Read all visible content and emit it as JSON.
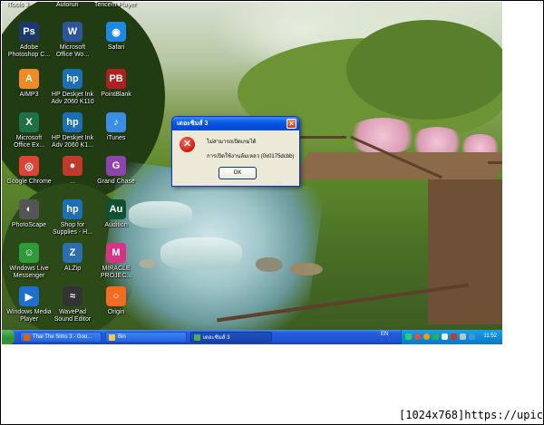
{
  "desktop_icons": [
    {
      "name": "photoshop",
      "label": "Adobe\nPhotoshop C...",
      "icon": "photoshop-icon",
      "color": "#1b3a6b",
      "glyph": "Ps"
    },
    {
      "name": "office-word",
      "label": "Microsoft\nOffice Wo...",
      "icon": "word-icon",
      "color": "#2b579a",
      "glyph": "W"
    },
    {
      "name": "safari",
      "label": "Safari",
      "icon": "compass-icon",
      "color": "#1e88e5",
      "glyph": "◉"
    },
    {
      "name": "aimp",
      "label": "AIMP3",
      "icon": "aimp-icon",
      "color": "#f08a24",
      "glyph": "A"
    },
    {
      "name": "hp-deskjet-1",
      "label": "HP Deskjet Ink\nAdv 2060 K110",
      "icon": "printer-icon",
      "color": "#1b6fb5",
      "glyph": "hp"
    },
    {
      "name": "pointblank",
      "label": "PointBlank",
      "icon": "pointblank-icon",
      "color": "#b02020",
      "glyph": "PB"
    },
    {
      "name": "office-excel",
      "label": "Microsoft\nOffice Ex...",
      "icon": "excel-icon",
      "color": "#1e7145",
      "glyph": "X"
    },
    {
      "name": "hp-deskjet-2",
      "label": "HP Deskjet Ink\nAdv 2060 K1...",
      "icon": "printer-icon",
      "color": "#1b6fb5",
      "glyph": "hp"
    },
    {
      "name": "itunes",
      "label": "iTunes",
      "icon": "itunes-icon",
      "color": "#3a8ee6",
      "glyph": "♪"
    },
    {
      "name": "google-chrome",
      "label": "Google Chrome",
      "icon": "chrome-icon",
      "color": "#db4437",
      "glyph": "◎"
    },
    {
      "name": "icon-blur",
      "label": "...",
      "icon": "app-icon",
      "color": "#c0392b",
      "glyph": "●"
    },
    {
      "name": "grand-chase",
      "label": "Grand Chase",
      "icon": "grandchase-icon",
      "color": "#8e44ad",
      "glyph": "G"
    },
    {
      "name": "photoscape",
      "label": "PhotoScape",
      "icon": "photoscape-icon",
      "color": "#555",
      "glyph": "◐"
    },
    {
      "name": "shop-supplies",
      "label": "Shop for\nSupplies - H...",
      "icon": "hp-shop-icon",
      "color": "#1b6fb5",
      "glyph": "hp"
    },
    {
      "name": "audition",
      "label": "Audition",
      "icon": "audition-icon",
      "color": "#0f5132",
      "glyph": "Au"
    },
    {
      "name": "windows-live-messenger",
      "label": "Windows Live\nMessenger",
      "icon": "messenger-icon",
      "color": "#2e9a3a",
      "glyph": "☺"
    },
    {
      "name": "alzip",
      "label": "ALZip",
      "icon": "alzip-icon",
      "color": "#2c6fb0",
      "glyph": "Z"
    },
    {
      "name": "miracle-project",
      "label": "MIRACLE\nPROJEC...",
      "icon": "miracle-icon",
      "color": "#d63384",
      "glyph": "M"
    },
    {
      "name": "windows-media-player",
      "label": "Windows Media\nPlayer",
      "icon": "media-player-icon",
      "color": "#1e6fd0",
      "glyph": "▶"
    },
    {
      "name": "wavepad",
      "label": "WavePad\nSound Editor",
      "icon": "wavepad-icon",
      "color": "#333",
      "glyph": "≈"
    },
    {
      "name": "origin",
      "label": "Origin",
      "icon": "origin-icon",
      "color": "#f26d21",
      "glyph": "○"
    }
  ],
  "top_cut_labels": [
    "iTools 3",
    "Autorun",
    "Tencent Player"
  ],
  "dialog": {
    "title": "เดอะซิมส์ 3",
    "message_line1": "ไม่สามารถเปิดเกมได้",
    "message_line2": "การเปิดใช้งานล้มเหลว (0x0175dcbb)",
    "ok_label": "OK"
  },
  "taskbar": {
    "tasks": [
      {
        "label": "Thai The Sims 3 - Goo...",
        "icon": "firefox-icon",
        "active": false
      },
      {
        "label": "Bin",
        "icon": "folder-icon",
        "active": false
      },
      {
        "label": "เดอะซิมส์ 3",
        "icon": "sims-icon",
        "active": true
      }
    ],
    "language": "EN",
    "clock": "11:52",
    "colors": {
      "start": "#3c9a3c",
      "bar": "#245edb",
      "tray": "#0e8ad6"
    }
  },
  "watermark": {
    "resolution": "[1024x768]",
    "site": "https://upic.me/"
  }
}
